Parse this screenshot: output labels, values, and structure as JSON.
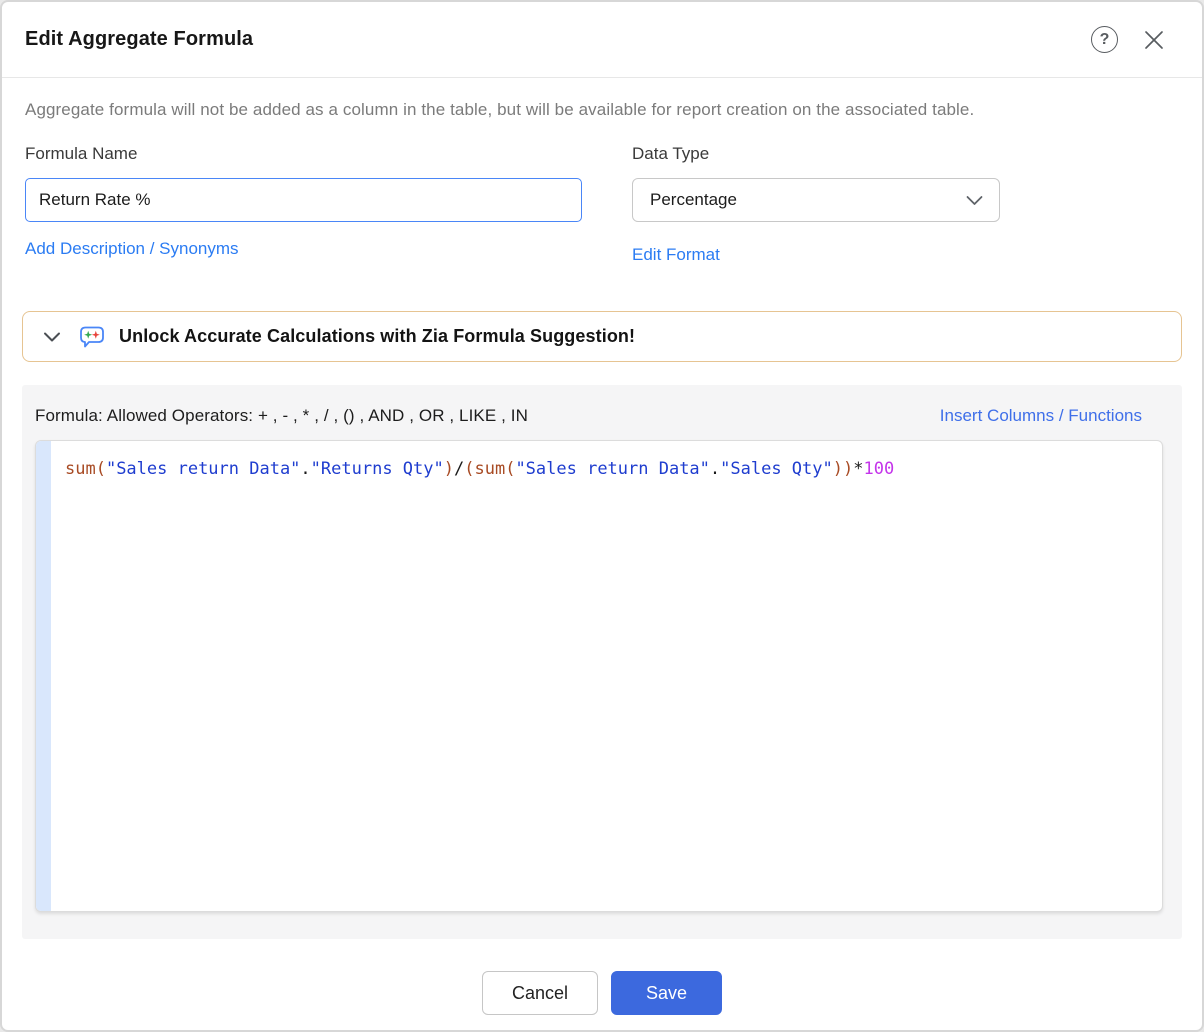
{
  "header": {
    "title": "Edit Aggregate Formula"
  },
  "description": "Aggregate formula will not be added as a column in the table, but will be available for report creation on the associated table.",
  "form": {
    "formula_name": {
      "label": "Formula Name",
      "value": "Return Rate %"
    },
    "data_type": {
      "label": "Data Type",
      "value": "Percentage"
    },
    "add_description_link": "Add Description / Synonyms",
    "edit_format_link": "Edit Format"
  },
  "zia_banner": {
    "text": "Unlock Accurate Calculations with Zia Formula Suggestion!",
    "icon": "zia-sparkles-chat-bubble"
  },
  "formula_section": {
    "header": "Formula: Allowed Operators: + , - , * , / , () , AND , OR , LIKE , IN",
    "insert_link": "Insert Columns / Functions",
    "code_full": "sum(\"Sales return Data\".\"Returns Qty\")/(sum(\"Sales return Data\".\"Sales Qty\"))*100",
    "code_tokens": [
      {
        "text": "sum(",
        "type": "function"
      },
      {
        "text": "\"Sales return Data\"",
        "type": "string"
      },
      {
        "text": ".",
        "type": "plain"
      },
      {
        "text": "\"Returns Qty\"",
        "type": "string"
      },
      {
        "text": ")",
        "type": "function"
      },
      {
        "text": "/",
        "type": "plain"
      },
      {
        "text": "(",
        "type": "function"
      },
      {
        "text": "sum(",
        "type": "function"
      },
      {
        "text": "\"Sales return Data\"",
        "type": "string"
      },
      {
        "text": ".",
        "type": "plain"
      },
      {
        "text": "\"Sales Qty\"",
        "type": "string"
      },
      {
        "text": "))",
        "type": "function"
      },
      {
        "text": "*",
        "type": "plain"
      },
      {
        "text": "100",
        "type": "number"
      }
    ]
  },
  "footer": {
    "cancel_label": "Cancel",
    "save_label": "Save"
  },
  "icons": {
    "help": "question-mark-circle",
    "close": "x-cross",
    "banner_chevron": "chevron-down",
    "select_chevron": "chevron-down"
  },
  "colors": {
    "modal_border": "#d7d7d7",
    "link_blue": "#2b7cf3",
    "insert_link_blue": "#3f6fe9",
    "input_focus_border": "#4a86f7",
    "banner_border": "#e6c492",
    "panel_bg": "#f5f5f6",
    "gutter_blue": "#d9e7fc",
    "save_blue": "#3c69de",
    "code_function": "#a84b24",
    "code_string": "#1f3dcf",
    "code_number": "#c435ea",
    "code_plain": "#1a1a1a"
  }
}
